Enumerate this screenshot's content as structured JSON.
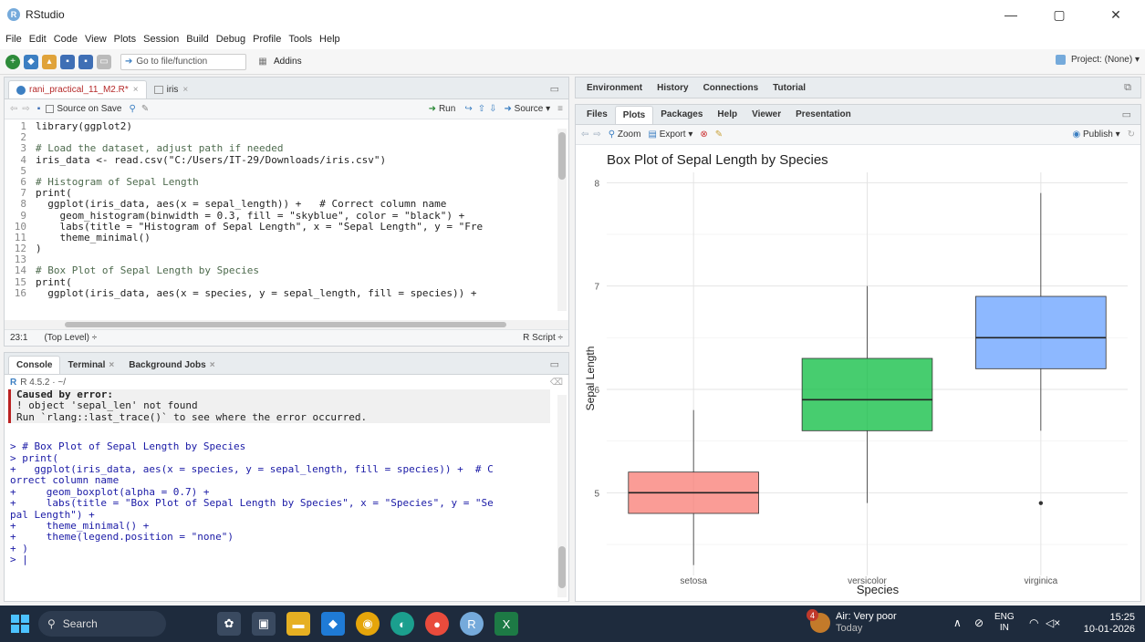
{
  "window": {
    "title": "RStudio",
    "minimize": "—",
    "maximize": "▢",
    "close": "✕"
  },
  "menu": [
    "File",
    "Edit",
    "Code",
    "View",
    "Plots",
    "Session",
    "Build",
    "Debug",
    "Profile",
    "Tools",
    "Help"
  ],
  "toolbar": {
    "goto_label": "Go to file/function",
    "addins_label": "Addins",
    "project_label": "Project: (None)"
  },
  "editor": {
    "tabs": [
      "rani_practical_11_M2.R*",
      "iris"
    ],
    "source_on_save": "Source on Save",
    "run_label": "Run",
    "source_label": "Source",
    "position": "23:1",
    "scope": "(Top Level)",
    "filetype": "R Script",
    "lines": [
      {
        "n": "1",
        "code": "library(ggplot2)"
      },
      {
        "n": "2",
        "code": ""
      },
      {
        "n": "3",
        "code": "# Load the dataset, adjust path if needed"
      },
      {
        "n": "4",
        "code": "iris_data <- read.csv(\"C:/Users/IT-29/Downloads/iris.csv\")"
      },
      {
        "n": "5",
        "code": ""
      },
      {
        "n": "6",
        "code": "# Histogram of Sepal Length"
      },
      {
        "n": "7",
        "code": "print("
      },
      {
        "n": "8",
        "code": "  ggplot(iris_data, aes(x = sepal_length)) +   # Correct column name"
      },
      {
        "n": "9",
        "code": "    geom_histogram(binwidth = 0.3, fill = \"skyblue\", color = \"black\") +"
      },
      {
        "n": "10",
        "code": "    labs(title = \"Histogram of Sepal Length\", x = \"Sepal Length\", y = \"Fre"
      },
      {
        "n": "11",
        "code": "    theme_minimal()"
      },
      {
        "n": "12",
        "code": ")"
      },
      {
        "n": "13",
        "code": ""
      },
      {
        "n": "14",
        "code": "# Box Plot of Sepal Length by Species"
      },
      {
        "n": "15",
        "code": "print("
      },
      {
        "n": "16",
        "code": "  ggplot(iris_data, aes(x = species, y = sepal_length, fill = species)) +"
      }
    ]
  },
  "console": {
    "tabs": [
      "Console",
      "Terminal",
      "Background Jobs"
    ],
    "r_version": "R 4.5.2 · ~/",
    "lines": [
      "Caused by error:",
      "! object 'sepal_len' not found",
      "Run `rlang::last_trace()` to see where the error occurred.",
      "",
      "> # Box Plot of Sepal Length by Species",
      "> print(",
      "+   ggplot(iris_data, aes(x = species, y = sepal_length, fill = species)) +  # C",
      "orrect column name",
      "+     geom_boxplot(alpha = 0.7) +",
      "+     labs(title = \"Box Plot of Sepal Length by Species\", x = \"Species\", y = \"Se",
      "pal Length\") +",
      "+     theme_minimal() +",
      "+     theme(legend.position = \"none\")",
      "+ )",
      "> |"
    ]
  },
  "env_pane": {
    "tabs": [
      "Environment",
      "History",
      "Connections",
      "Tutorial"
    ]
  },
  "files_pane": {
    "tabs": [
      "Files",
      "Plots",
      "Packages",
      "Help",
      "Viewer",
      "Presentation"
    ],
    "zoom_label": "Zoom",
    "export_label": "Export",
    "publish_label": "Publish"
  },
  "chart_data": {
    "type": "boxplot",
    "title": "Box Plot of Sepal Length by Species",
    "xlabel": "Species",
    "ylabel": "Sepal Length",
    "ylim": [
      4.2,
      8.1
    ],
    "yticks": [
      5,
      6,
      7,
      8
    ],
    "categories": [
      "setosa",
      "versicolor",
      "virginica"
    ],
    "colors": [
      "#f8766d",
      "#00ba38",
      "#619cff"
    ],
    "boxes": [
      {
        "category": "setosa",
        "min": 4.3,
        "q1": 4.8,
        "median": 5.0,
        "q3": 5.2,
        "max": 5.8,
        "outliers": []
      },
      {
        "category": "versicolor",
        "min": 4.9,
        "q1": 5.6,
        "median": 5.9,
        "q3": 6.3,
        "max": 7.0,
        "outliers": []
      },
      {
        "category": "virginica",
        "min": 5.6,
        "q1": 6.2,
        "median": 6.5,
        "q3": 6.9,
        "max": 7.9,
        "outliers": [
          4.9
        ]
      }
    ],
    "grid": true,
    "legend": "none"
  },
  "taskbar": {
    "search_label": "Search",
    "weather_title": "Air: Very poor",
    "weather_sub": "Today",
    "weather_badge": "4",
    "lang_top": "ENG",
    "lang_bottom": "IN",
    "time": "15:25",
    "date": "10-01-2026"
  }
}
